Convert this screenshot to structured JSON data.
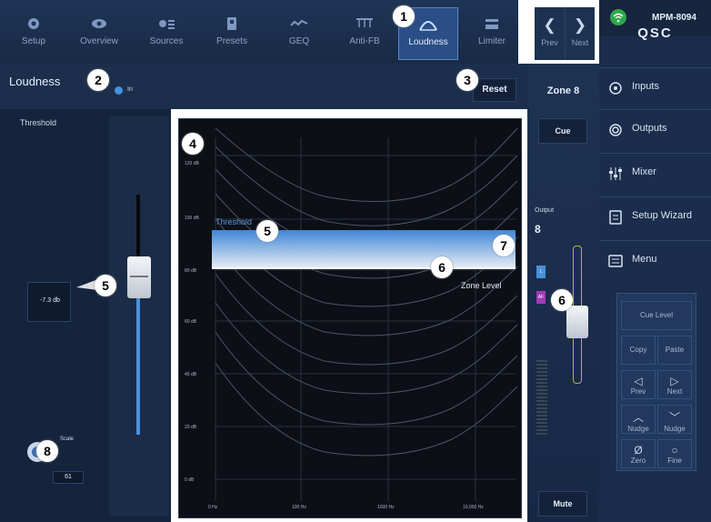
{
  "nav": {
    "tabs": [
      {
        "label": "Setup",
        "icon": "gear-icon"
      },
      {
        "label": "Overview",
        "icon": "eye-icon"
      },
      {
        "label": "Sources",
        "icon": "sources-icon"
      },
      {
        "label": "Presets",
        "icon": "presets-icon"
      },
      {
        "label": "GEQ",
        "icon": "geq-icon"
      },
      {
        "label": "Anti-FB",
        "icon": "antifb-icon"
      },
      {
        "label": "Loudness",
        "icon": "loudness-icon"
      },
      {
        "label": "Limiter",
        "icon": "limiter-icon"
      }
    ],
    "active": "Loudness",
    "prev_label": "Prev",
    "next_label": "Next"
  },
  "brand": {
    "logo": "QSC"
  },
  "sidebar": {
    "items": [
      {
        "label": "Inputs",
        "icon": "inputs-icon"
      },
      {
        "label": "Outputs",
        "icon": "outputs-icon"
      },
      {
        "label": "Mixer",
        "icon": "mixer-icon"
      },
      {
        "label": "Setup Wizard",
        "icon": "wizard-icon"
      },
      {
        "label": "Menu",
        "icon": "menu-icon"
      }
    ],
    "keypad": {
      "cue_level": "Cue Level",
      "copy": "Copy",
      "paste": "Paste",
      "prev": "Prev",
      "next": "Next",
      "nudge_up": "Nudge",
      "nudge_down": "Nudge",
      "zero": "Zero",
      "fine": "Fine"
    },
    "device": "MPM-8094"
  },
  "loudness": {
    "title": "Loudness",
    "in_label": "In",
    "reset_label": "Reset",
    "threshold_label": "Threshold",
    "threshold_value": "-7.3 db",
    "scale_label": "Scale",
    "scale_value": "61",
    "graph": {
      "y_ticks": [
        "120 dB",
        "100 dB",
        "80 dB",
        "60 dB",
        "40 dB",
        "20 dB",
        "0 dB"
      ],
      "x_ticks": [
        "0 Hz",
        "100 Hz",
        "1000 Hz",
        "10,000 Hz"
      ],
      "threshold_text": "Threshold",
      "zone_level_text": "Zone Level"
    }
  },
  "zone": {
    "title": "Zone 8",
    "cue_label": "Cue",
    "output_label": "Output",
    "output_number": "8",
    "l_label": "L",
    "af_label": "AF",
    "mute_label": "Mute"
  },
  "callouts": [
    "1",
    "2",
    "3",
    "4",
    "5",
    "5",
    "6",
    "6",
    "7",
    "8"
  ],
  "colors": {
    "accent": "#4a90d9",
    "active_tab": "#2a4e86",
    "background": "#14243d"
  }
}
